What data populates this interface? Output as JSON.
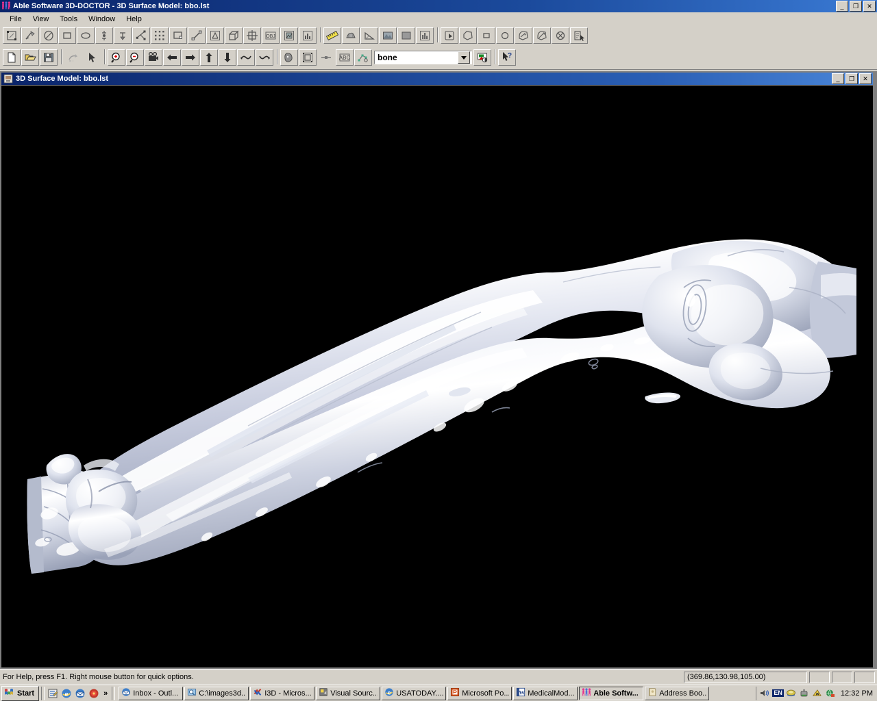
{
  "window": {
    "title": "Able Software 3D-DOCTOR - 3D Surface Model: bbo.lst",
    "icon": "able-software-logo-icon",
    "minimize_label": "_",
    "maximize_label": "❐",
    "close_label": "✕"
  },
  "menu": {
    "items": [
      {
        "label": "File"
      },
      {
        "label": "View"
      },
      {
        "label": "Tools"
      },
      {
        "label": "Window"
      },
      {
        "label": "Help"
      }
    ]
  },
  "toolbar_top": {
    "buttons": [
      {
        "name": "select-region-tool",
        "icon": "marquee-select-icon"
      },
      {
        "name": "draw-line-tool",
        "icon": "pencil-line-icon"
      },
      {
        "name": "draw-freehand-tool",
        "icon": "freehand-ellipse-icon"
      },
      {
        "name": "draw-rectangle-tool",
        "icon": "rectangle-icon"
      },
      {
        "name": "draw-ellipse-tool",
        "icon": "ellipse-icon"
      },
      {
        "name": "add-point-above-tool",
        "icon": "point-vertical-icon"
      },
      {
        "name": "add-point-below-tool",
        "icon": "point-down-icon"
      },
      {
        "name": "polyline-tool",
        "icon": "polyline-node-icon"
      },
      {
        "name": "scatter-points-tool",
        "icon": "scatter-points-icon"
      },
      {
        "name": "boundary-box-tool",
        "icon": "boundary-rect-icon"
      },
      {
        "name": "measure-distance-tool",
        "icon": "measure-diagonal-icon"
      },
      {
        "name": "landmark-tool",
        "icon": "landmark-frame-icon"
      },
      {
        "name": "extrude-tool",
        "icon": "cube-extrude-icon"
      },
      {
        "name": "grid-tool",
        "icon": "grid-frame-icon"
      },
      {
        "name": "object-list-tool",
        "icon": "obj-label-icon"
      },
      {
        "name": "image-tool",
        "icon": "image-frame-icon"
      },
      {
        "name": "histogram-tool",
        "icon": "histogram-icon"
      }
    ],
    "buttons2": [
      {
        "name": "ruler-tool",
        "icon": "ruler-icon",
        "pressed": true
      },
      {
        "name": "surface-render-tool",
        "icon": "surface-mesh-icon"
      },
      {
        "name": "angle-tool",
        "icon": "angle-icon"
      },
      {
        "name": "picture-tool",
        "icon": "picture-icon"
      },
      {
        "name": "fill-solid-tool",
        "icon": "solid-fill-icon"
      },
      {
        "name": "chart-tool",
        "icon": "bar-chart-icon"
      }
    ],
    "buttons3": [
      {
        "name": "region-grow-tool",
        "icon": "region-grow-icon"
      },
      {
        "name": "polygon-roi-tool",
        "icon": "polygon-roi-icon"
      },
      {
        "name": "rect-roi-tool",
        "icon": "rect-roi-icon"
      },
      {
        "name": "circle-roi-tool",
        "icon": "circle-roi-icon"
      },
      {
        "name": "add-roi-tool",
        "icon": "add-roi-icon"
      },
      {
        "name": "subtract-roi-tool",
        "icon": "subtract-roi-icon"
      },
      {
        "name": "delete-roi-tool",
        "icon": "delete-roi-icon"
      },
      {
        "name": "roi-select-tool",
        "icon": "roi-select-icon"
      }
    ]
  },
  "toolbar_bottom": {
    "buttons": [
      {
        "name": "new-file-button",
        "icon": "new-document-icon"
      },
      {
        "name": "open-file-button",
        "icon": "open-folder-icon"
      },
      {
        "name": "save-file-button",
        "icon": "floppy-save-icon"
      }
    ],
    "buttons2": [
      {
        "name": "undo-button",
        "icon": "undo-arrow-icon"
      },
      {
        "name": "pointer-button",
        "icon": "arrow-pointer-icon"
      }
    ],
    "buttons3": [
      {
        "name": "zoom-in-button",
        "icon": "magnifier-plus-icon"
      },
      {
        "name": "zoom-out-button",
        "icon": "magnifier-minus-icon"
      },
      {
        "name": "animate-button",
        "icon": "movie-camera-icon"
      },
      {
        "name": "pan-left-button",
        "icon": "arrow-left-icon"
      },
      {
        "name": "pan-right-button",
        "icon": "arrow-right-icon"
      },
      {
        "name": "pan-up-button",
        "icon": "arrow-up-icon"
      },
      {
        "name": "pan-down-button",
        "icon": "arrow-down-icon"
      },
      {
        "name": "rotate-ccw-button",
        "icon": "rotate-ccw-icon"
      },
      {
        "name": "rotate-cw-button",
        "icon": "rotate-cw-icon"
      }
    ],
    "buttons4": [
      {
        "name": "render-head-button",
        "icon": "head-render-icon"
      },
      {
        "name": "fit-window-button",
        "icon": "fit-frame-icon"
      },
      {
        "name": "slice-button",
        "icon": "slice-line-icon"
      },
      {
        "name": "text-annotation-button",
        "icon": "abc-text-icon"
      },
      {
        "name": "vector-points-button",
        "icon": "vector-points-icon"
      }
    ],
    "object_combo": {
      "name": "object-select-combo",
      "value": "bone",
      "arrow": "chevron-down-icon"
    },
    "buttons5": [
      {
        "name": "color-palette-button",
        "icon": "color-palette-icon"
      }
    ],
    "buttons6": [
      {
        "name": "context-help-button",
        "icon": "arrow-question-help-icon"
      }
    ]
  },
  "mdi_child": {
    "title": "3D Surface Model: bbo.lst",
    "icon": "3d-model-document-icon",
    "minimize_label": "_",
    "restore_label": "❐",
    "close_label": "✕",
    "canvas": {
      "name": "3d-surface-model-viewport",
      "background": "#000000",
      "model": "bone-surface-mesh",
      "description": "3D rendered white bone surface model (forearm radius and ulna with wrist and elbow joints) on black background"
    }
  },
  "statusbar": {
    "help_text": "For Help, press F1. Right mouse button for quick options.",
    "coordinates": "(369.86,130.98,105.00)",
    "pane2": "",
    "pane3": "",
    "pane4": ""
  },
  "taskbar": {
    "start_label": "Start",
    "start_icon": "windows-flag-icon",
    "quick_launch": [
      {
        "name": "show-desktop-icon",
        "icon": "desktop-notes-icon"
      },
      {
        "name": "internet-explorer-icon",
        "icon": "ie-e-icon"
      },
      {
        "name": "outlook-express-icon",
        "icon": "outlook-mail-icon"
      },
      {
        "name": "media-player-icon",
        "icon": "media-orb-icon"
      }
    ],
    "quick_launch_more": "»",
    "tasks": [
      {
        "name": "task-inbox-outlook",
        "label": "Inbox - Outl...",
        "icon": "outlook-mail-icon",
        "active": false
      },
      {
        "name": "task-images3d-folder",
        "label": "C:\\images3d...",
        "icon": "folder-search-icon",
        "active": false
      },
      {
        "name": "task-i3d-microsoft",
        "label": "I3D - Micros...",
        "icon": "visual-studio-icon",
        "active": false
      },
      {
        "name": "task-visual-source",
        "label": "Visual Sourc...",
        "icon": "source-safe-icon",
        "active": false
      },
      {
        "name": "task-usatoday",
        "label": "USATODAY....",
        "icon": "ie-e-icon",
        "active": false
      },
      {
        "name": "task-microsoft-powerpoint",
        "label": "Microsoft Po...",
        "icon": "powerpoint-icon",
        "active": false
      },
      {
        "name": "task-medicalmodel-word",
        "label": "MedicalMod...",
        "icon": "word-icon",
        "active": false
      },
      {
        "name": "task-able-software",
        "label": "Able Softw...",
        "icon": "able-software-logo-icon",
        "active": true
      },
      {
        "name": "task-address-book",
        "label": "Address Boo...",
        "icon": "address-book-icon",
        "active": false
      }
    ],
    "tray": {
      "icons": [
        {
          "name": "volume-icon",
          "icon": "speaker-volume-icon"
        },
        {
          "name": "language-indicator",
          "icon": "en-language-badge",
          "label": "EN"
        },
        {
          "name": "network-icon",
          "icon": "network-disk-icon"
        },
        {
          "name": "safely-remove-icon",
          "icon": "safely-remove-hardware-icon"
        },
        {
          "name": "antivirus-icon",
          "icon": "antivirus-shield-icon"
        },
        {
          "name": "display-icon",
          "icon": "display-globe-icon"
        }
      ],
      "clock": "12:32 PM"
    }
  }
}
